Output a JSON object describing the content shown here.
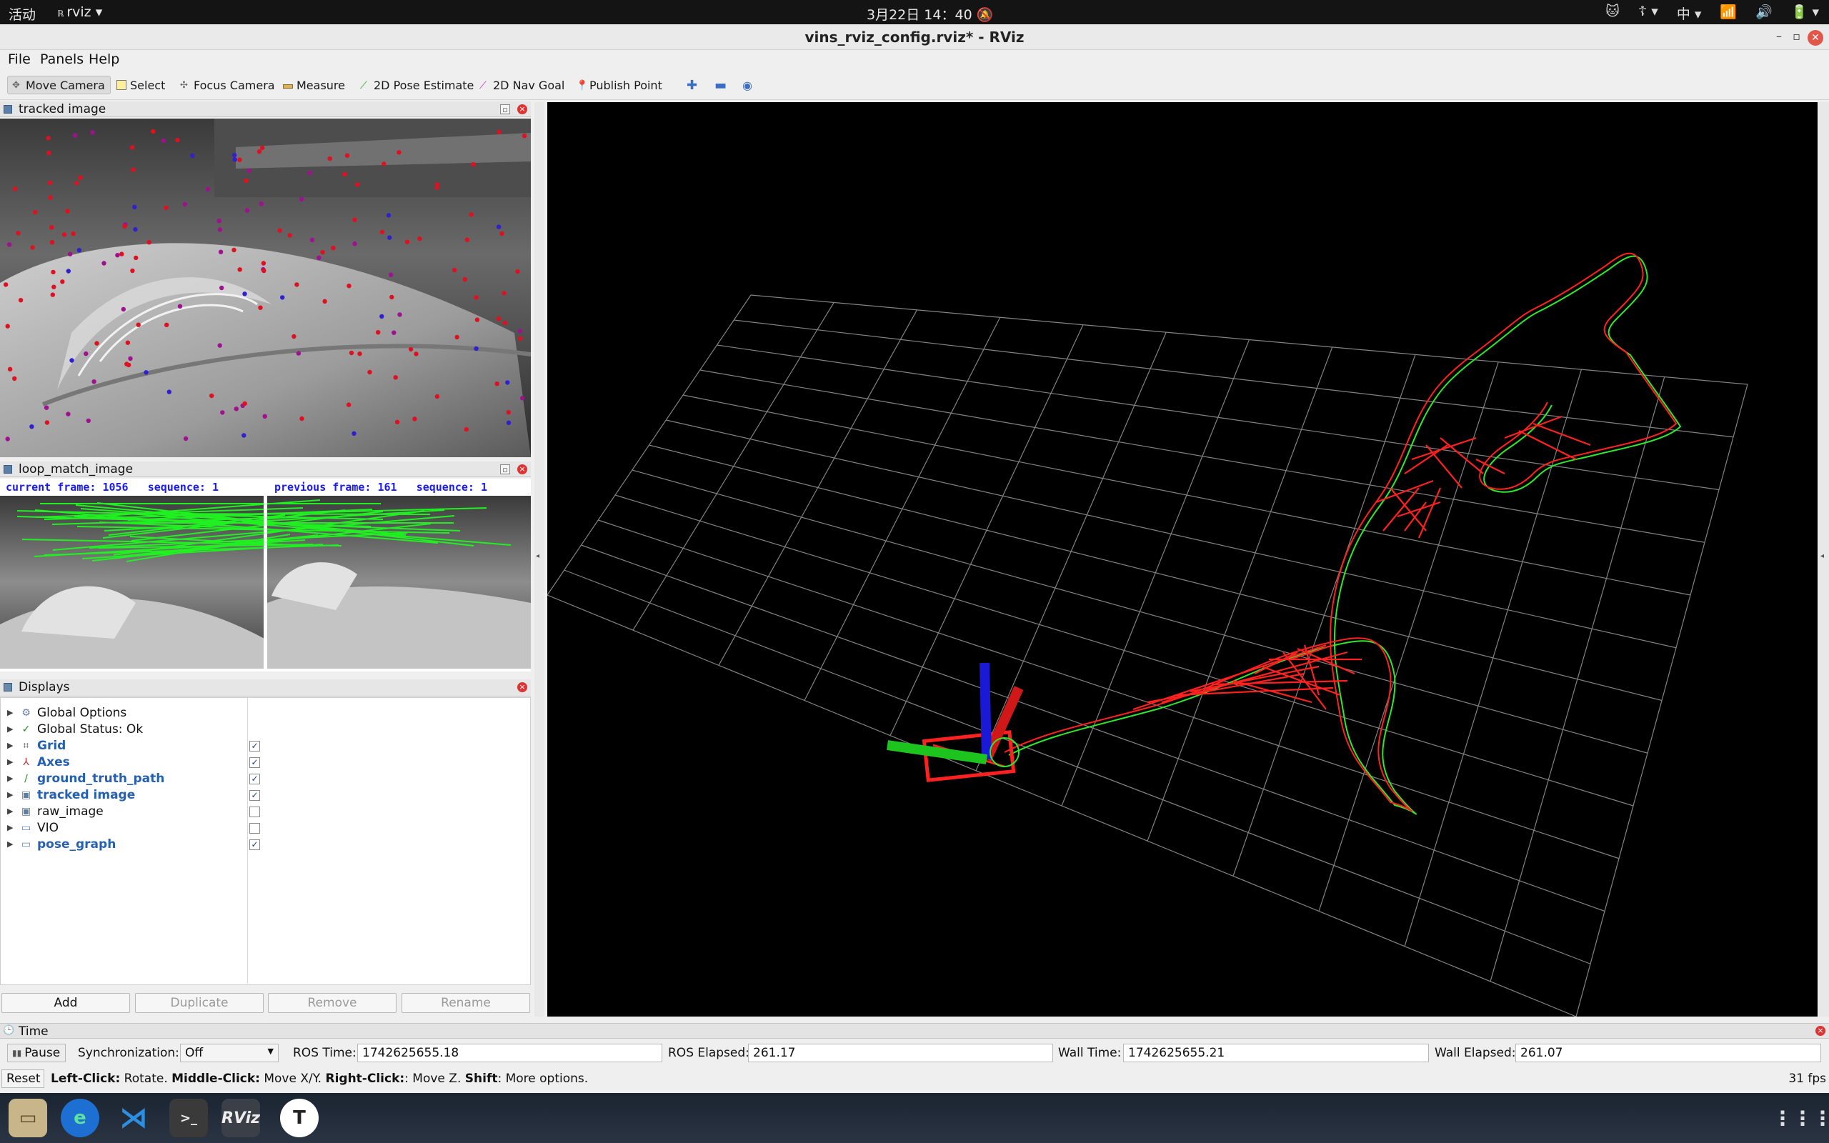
{
  "topbar": {
    "activities": "活动",
    "app_menu": "rviz",
    "clock": "3月22日  14：40",
    "input_method": "中"
  },
  "window": {
    "title": "vins_rviz_config.rviz* - RViz"
  },
  "menu": {
    "file": "File",
    "panels": "Panels",
    "help": "Help"
  },
  "toolbar": {
    "tools": [
      "Move Camera",
      "Select",
      "Focus Camera",
      "Measure",
      "2D Pose Estimate",
      "2D Nav Goal",
      "Publish Point"
    ],
    "active": "Move Camera"
  },
  "panels": {
    "tracked_image": {
      "title": "tracked image"
    },
    "loop_match_image": {
      "title": "loop_match_image",
      "current_frame_label": "current frame:",
      "current_frame": "1056",
      "current_sequence_label": "sequence:",
      "current_sequence": "1",
      "previous_frame_label": "previous frame:",
      "previous_frame": "161",
      "previous_sequence_label": "sequence:",
      "previous_sequence": "1"
    },
    "displays": {
      "title": "Displays",
      "items": [
        {
          "label": "Global Options",
          "icon": "gear-icon",
          "checked": null,
          "highlight": false
        },
        {
          "label": "Global Status: Ok",
          "icon": "check-icon",
          "checked": null,
          "highlight": false
        },
        {
          "label": "Grid",
          "icon": "grid-icon",
          "checked": true,
          "highlight": true
        },
        {
          "label": "Axes",
          "icon": "axes-icon",
          "checked": true,
          "highlight": true
        },
        {
          "label": "ground_truth_path",
          "icon": "path-icon",
          "checked": true,
          "highlight": true
        },
        {
          "label": "tracked image",
          "icon": "image-icon",
          "checked": true,
          "highlight": true
        },
        {
          "label": "raw_image",
          "icon": "image-icon",
          "checked": false,
          "highlight": false
        },
        {
          "label": "VIO",
          "icon": "folder-icon",
          "checked": false,
          "highlight": false
        },
        {
          "label": "pose_graph",
          "icon": "folder-icon",
          "checked": true,
          "highlight": true
        }
      ],
      "buttons": {
        "add": "Add",
        "duplicate": "Duplicate",
        "remove": "Remove",
        "rename": "Rename"
      }
    }
  },
  "time": {
    "title": "Time",
    "pause": "Pause",
    "sync_label": "Synchronization:",
    "sync_value": "Off",
    "ros_time_label": "ROS Time:",
    "ros_time": "1742625655.18",
    "ros_elapsed_label": "ROS Elapsed:",
    "ros_elapsed": "261.17",
    "wall_time_label": "Wall Time:",
    "wall_time": "1742625655.21",
    "wall_elapsed_label": "Wall Elapsed:",
    "wall_elapsed": "261.07"
  },
  "statusbar": {
    "reset": "Reset",
    "hint_left_key": "Left-Click:",
    "hint_left": "Rotate.",
    "hint_middle_key": "Middle-Click:",
    "hint_middle": "Move X/Y.",
    "hint_right_key": "Right-Click:",
    "hint_right": ": Move Z.",
    "hint_shift_key": "Shift",
    "hint_shift": ": More options.",
    "fps": "31 fps"
  },
  "dock": [
    "files-icon",
    "edge-icon",
    "vscode-icon",
    "terminal-icon",
    "rviz-icon",
    "typora-icon"
  ],
  "colors": {
    "accent": "#2660b0",
    "close": "#d33333",
    "path_red": "#ff2020",
    "path_green": "#2ee82e"
  }
}
